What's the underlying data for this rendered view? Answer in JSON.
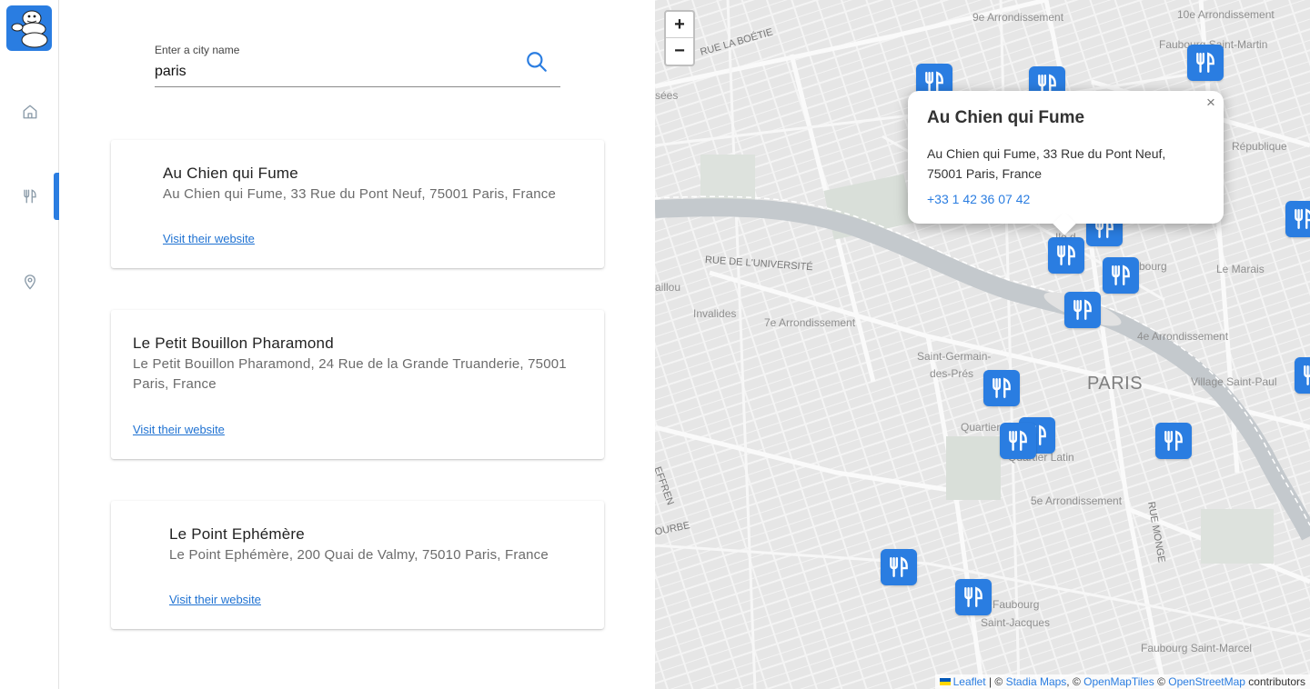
{
  "sidebar": {
    "logo_icon": "michelin-bibendum-logo",
    "items": [
      {
        "icon": "home-icon",
        "active": false
      },
      {
        "icon": "restaurant-icon",
        "active": true
      },
      {
        "icon": "location-pin-icon",
        "active": false
      }
    ]
  },
  "search": {
    "label": "Enter a city name",
    "value": "paris",
    "icon": "search-icon"
  },
  "restaurants": [
    {
      "name": "Au Chien qui Fume",
      "address_line1": "Au Chien qui Fume, 33 Rue du Pont Neuf, 75001 Paris, France",
      "address_line2": "",
      "link": "Visit their website"
    },
    {
      "name": "Le Petit Bouillon Pharamond",
      "address_line1": "Le Petit Bouillon Pharamond, 24 Rue de la Grande Truanderie, 75001",
      "address_line2": "Paris, France",
      "link": "Visit their website"
    },
    {
      "name": "Le Point Ephémère",
      "address_line1": "Le Point Ephémère, 200 Quai de Valmy, 75010 Paris, France",
      "address_line2": "",
      "link": "Visit their website"
    }
  ],
  "map": {
    "zoom_in": "+",
    "zoom_out": "−",
    "labels": {
      "arr9": "9e Arrondissement",
      "arr10": "10e Arrondissement",
      "faubourg_st_martin": "Faubourg Saint-Martin",
      "rue_boetie": "RUE LA BOÉTIE",
      "sees": "sées",
      "republique": "République",
      "rue_universite": "RUE DE L'UNIVERSITÉ",
      "gaillou": "aillou",
      "invalides": "Invalides",
      "arr7": "7e Arrondissement",
      "faubourg": "bourg",
      "le_marais": "Le Marais",
      "arr4": "4e Arrondissement",
      "saint_germain_1": "Saint-Germain-",
      "saint_germain_2": "des-Prés",
      "paris": "PARIS",
      "village_st_paul": "Village Saint-Paul",
      "quartier": "Quartier",
      "quartier_latin": "Quartier Latin",
      "effren": "EFFREN",
      "ourbe": "OURBE",
      "arr5": "5e Arrondissement",
      "rue_monge": "RUE MONGE",
      "faubourg_st_jacques_1": "Faubourg",
      "faubourg_st_jacques_2": "Saint-Jacques",
      "faubourg_st_marcel": "Faubourg Saint-Marcel",
      "ile": "Ile d"
    },
    "marker_icon": "fork-knife-icon",
    "marker_count": 17,
    "popup": {
      "title": "Au Chien qui Fume",
      "address_line1": "Au Chien qui Fume, 33 Rue du Pont Neuf,",
      "address_line2": "75001 Paris, France",
      "phone": "+33 1 42 36 07 42",
      "close": "×"
    },
    "attribution": {
      "leaflet": "Leaflet",
      "sep1": " | © ",
      "stadia": "Stadia Maps",
      "sep2": ", © ",
      "openmaptiles": "OpenMapTiles",
      "sep3": " © ",
      "osm": "OpenStreetMap",
      "contributors": " contributors"
    }
  },
  "colors": {
    "accent": "#2a7de1",
    "link": "#1f72d2",
    "map_bg": "#e9e9e9",
    "river": "#c4c9cd",
    "park": "#d9dfd9"
  }
}
